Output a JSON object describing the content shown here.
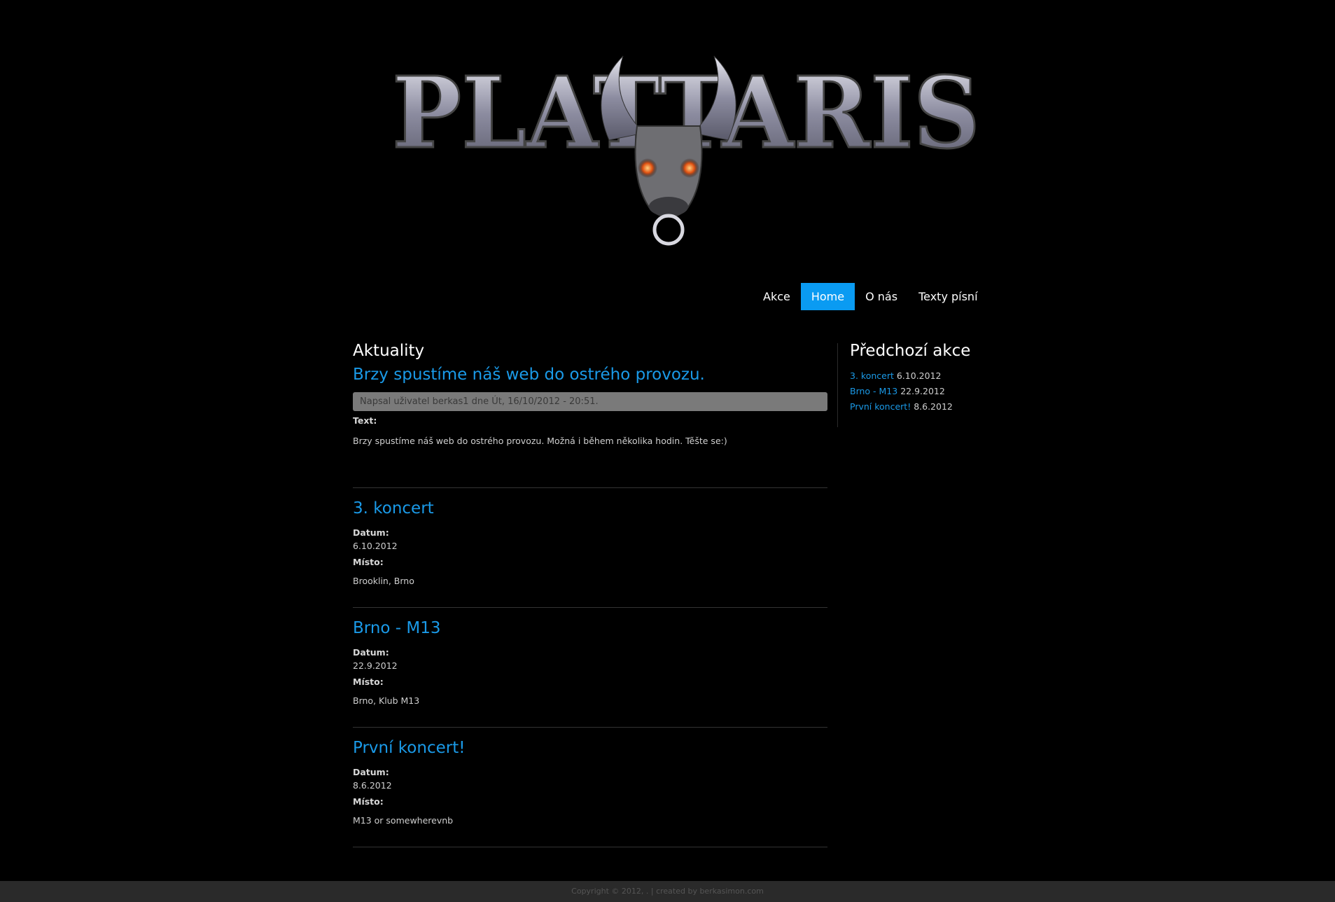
{
  "logo": {
    "text": "PLATTARIS"
  },
  "nav": {
    "items": [
      {
        "label": "Akce",
        "active": false
      },
      {
        "label": "Home",
        "active": true
      },
      {
        "label": "O nás",
        "active": false
      },
      {
        "label": "Texty písní",
        "active": false
      }
    ]
  },
  "main": {
    "section_title": "Aktuality",
    "post": {
      "title": "Brzy spustíme náš web do ostrého provozu.",
      "submitted": "Napsal uživatel berkas1 dne Út, 16/10/2012 - 20:51.",
      "text_label": "Text:",
      "body": "Brzy spustíme náš web do ostrého provozu. Možná i během několika hodin. Těšte se:)"
    },
    "events": [
      {
        "title": "3. koncert",
        "date_label": "Datum:",
        "date": "6.10.2012",
        "place_label": "Místo:",
        "place": "Brooklin, Brno"
      },
      {
        "title": "Brno - M13",
        "date_label": "Datum:",
        "date": "22.9.2012",
        "place_label": "Místo:",
        "place": "Brno, Klub M13"
      },
      {
        "title": "První koncert!",
        "date_label": "Datum:",
        "date": "8.6.2012",
        "place_label": "Místo:",
        "place": "M13 or somewherevnb"
      }
    ]
  },
  "sidebar": {
    "title": "Předchozí akce",
    "items": [
      {
        "link": "3. koncert",
        "date": "6.10.2012"
      },
      {
        "link": "Brno - M13",
        "date": "22.9.2012"
      },
      {
        "link": "První koncert!",
        "date": "8.6.2012"
      }
    ]
  },
  "footer": {
    "text": "Copyright © 2012, . | created by berkasimon.com"
  },
  "colors": {
    "accent": "#0a9bf2",
    "link": "#1a9ae8",
    "background": "#000000"
  }
}
